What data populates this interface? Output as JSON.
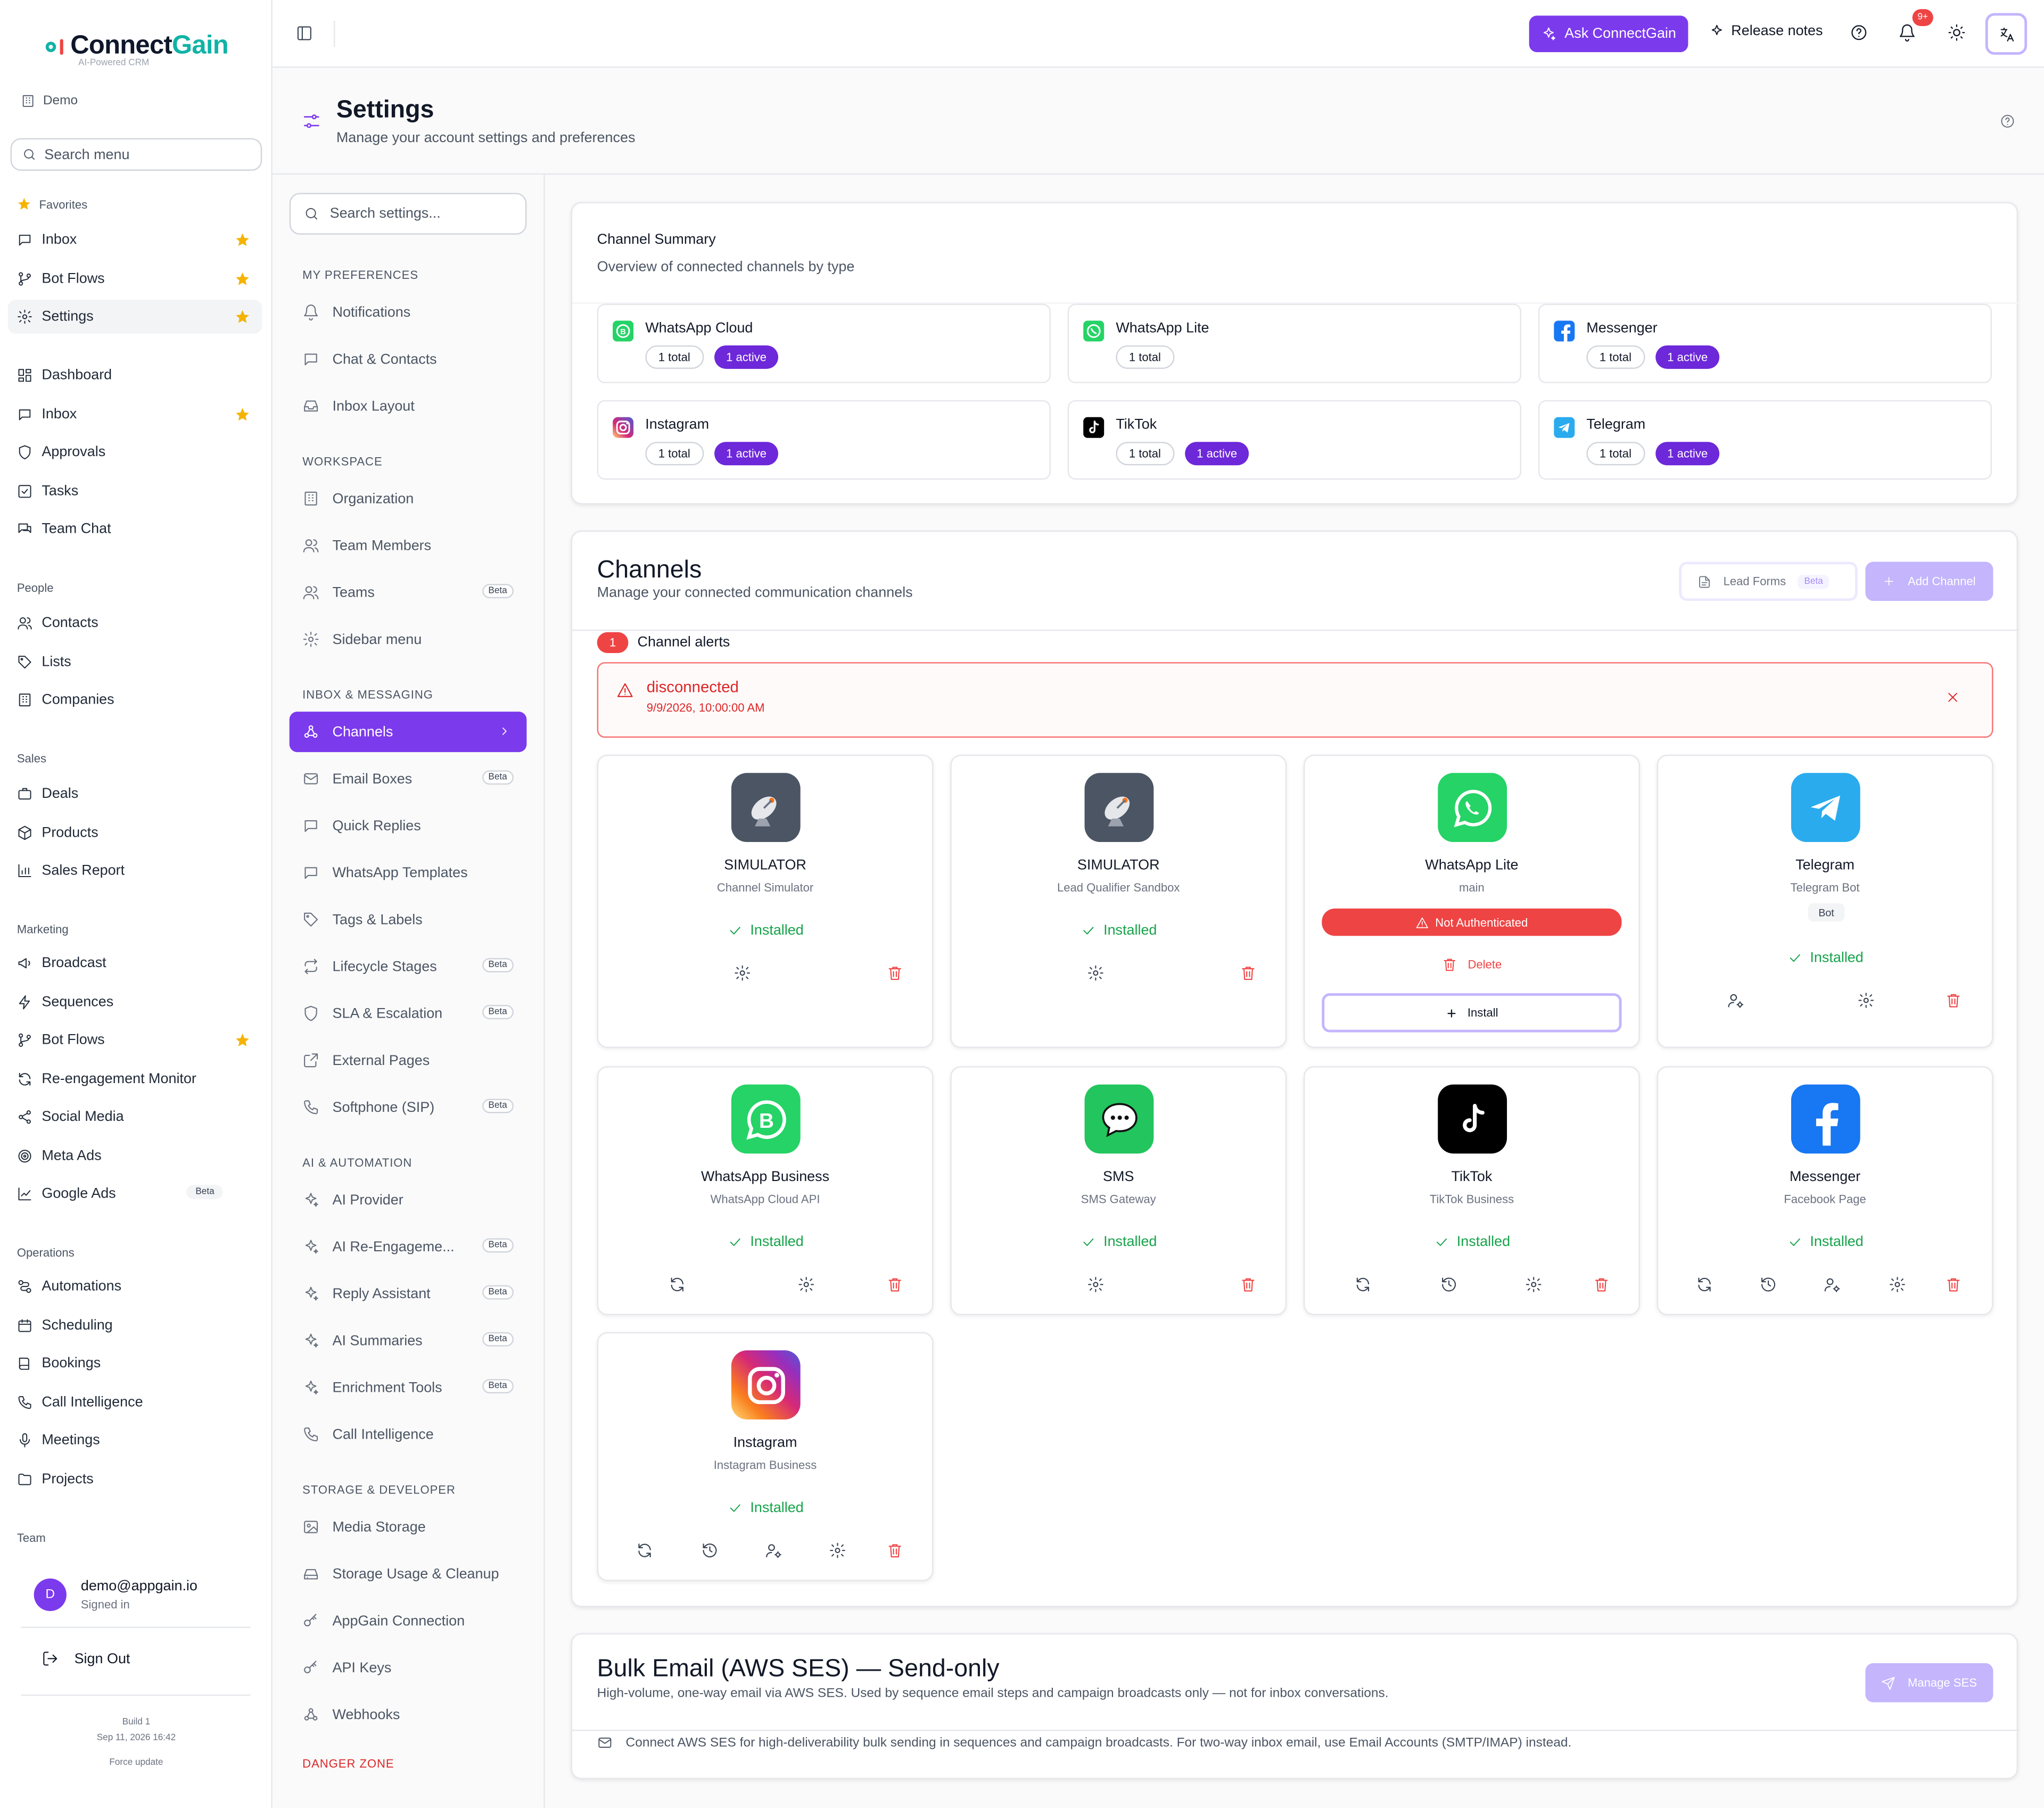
{
  "brand": {
    "name_a": "Connect",
    "name_b": "Gain",
    "tagline": "AI-Powered CRM"
  },
  "org": {
    "name": "Demo"
  },
  "sidebar": {
    "search_placeholder": "Search menu",
    "favorites_label": "Favorites",
    "favorites": [
      "Inbox",
      "Bot Flows",
      "Settings"
    ],
    "main": [
      "Dashboard",
      "Inbox",
      "Approvals",
      "Tasks",
      "Team Chat"
    ],
    "people_label": "People",
    "people": [
      "Contacts",
      "Lists",
      "Companies"
    ],
    "sales_label": "Sales",
    "sales": [
      "Deals",
      "Products",
      "Sales Report"
    ],
    "marketing_label": "Marketing",
    "marketing": [
      "Broadcast",
      "Sequences",
      "Bot Flows",
      "Re-engagement Monitor",
      "Social Media",
      "Meta Ads",
      "Google Ads"
    ],
    "google_ads_badge": "Beta",
    "operations_label": "Operations",
    "operations": [
      "Automations",
      "Scheduling",
      "Bookings",
      "Call Intelligence",
      "Meetings",
      "Projects"
    ],
    "team_label": "Team",
    "user": {
      "initial": "D",
      "email": "demo@appgain.io",
      "status": "Signed in"
    },
    "sign_out": "Sign Out",
    "build": "Build 1",
    "build_date": "Sep 11, 2026 16:42",
    "force_update": "Force update"
  },
  "topbar": {
    "ask": "Ask ConnectGain",
    "release_notes": "Release notes",
    "notif_count": "9+"
  },
  "page": {
    "title": "Settings",
    "subtitle": "Manage your account settings and preferences"
  },
  "settings_nav": {
    "search_placeholder": "Search settings...",
    "sections": [
      {
        "label": "MY PREFERENCES",
        "items": [
          {
            "label": "Notifications",
            "icon": "bell-icon"
          },
          {
            "label": "Chat & Contacts",
            "icon": "chat-icon"
          },
          {
            "label": "Inbox Layout",
            "icon": "inbox-icon"
          }
        ]
      },
      {
        "label": "WORKSPACE",
        "items": [
          {
            "label": "Organization",
            "icon": "building-icon"
          },
          {
            "label": "Team Members",
            "icon": "users-icon"
          },
          {
            "label": "Teams",
            "icon": "users-icon",
            "beta": "Beta"
          },
          {
            "label": "Sidebar menu",
            "icon": "gear-icon"
          }
        ]
      },
      {
        "label": "INBOX & MESSAGING",
        "items": [
          {
            "label": "Channels",
            "icon": "webhook-icon",
            "active": true
          },
          {
            "label": "Email Boxes",
            "icon": "mail-icon",
            "beta": "Beta"
          },
          {
            "label": "Quick Replies",
            "icon": "chat-icon"
          },
          {
            "label": "WhatsApp Templates",
            "icon": "chat-icon"
          },
          {
            "label": "Tags & Labels",
            "icon": "tag-icon"
          },
          {
            "label": "Lifecycle Stages",
            "icon": "repeat-icon",
            "beta": "Beta"
          },
          {
            "label": "SLA & Escalation",
            "icon": "shield-icon",
            "beta": "Beta"
          },
          {
            "label": "External Pages",
            "icon": "external-icon"
          },
          {
            "label": "Softphone (SIP)",
            "icon": "phone-icon",
            "beta": "Beta"
          }
        ]
      },
      {
        "label": "AI & AUTOMATION",
        "items": [
          {
            "label": "AI Provider",
            "icon": "sparkle-icon"
          },
          {
            "label": "AI Re-Engageme...",
            "icon": "sparkle-icon",
            "beta": "Beta"
          },
          {
            "label": "Reply Assistant",
            "icon": "sparkle-icon",
            "beta": "Beta"
          },
          {
            "label": "AI Summaries",
            "icon": "sparkle-icon",
            "beta": "Beta"
          },
          {
            "label": "Enrichment Tools",
            "icon": "sparkle-icon",
            "beta": "Beta"
          },
          {
            "label": "Call Intelligence",
            "icon": "phone-icon"
          }
        ]
      },
      {
        "label": "STORAGE & DEVELOPER",
        "items": [
          {
            "label": "Media Storage",
            "icon": "image-icon"
          },
          {
            "label": "Storage Usage & Cleanup",
            "icon": "drive-icon"
          },
          {
            "label": "AppGain Connection",
            "icon": "key-icon"
          },
          {
            "label": "API Keys",
            "icon": "key-icon"
          },
          {
            "label": "Webhooks",
            "icon": "webhook-icon"
          }
        ]
      }
    ],
    "danger_zone": "DANGER ZONE"
  },
  "summary": {
    "title": "Channel Summary",
    "subtitle": "Overview of connected channels by type",
    "items": [
      {
        "name": "WhatsApp Cloud",
        "total": "1 total",
        "active": "1 active"
      },
      {
        "name": "WhatsApp Lite",
        "total": "1 total"
      },
      {
        "name": "Messenger",
        "total": "1 total",
        "active": "1 active"
      },
      {
        "name": "Instagram",
        "total": "1 total",
        "active": "1 active"
      },
      {
        "name": "TikTok",
        "total": "1 total",
        "active": "1 active"
      },
      {
        "name": "Telegram",
        "total": "1 total",
        "active": "1 active"
      }
    ]
  },
  "channels": {
    "title": "Channels",
    "subtitle": "Manage your connected communication channels",
    "lead_forms": "Lead Forms",
    "lead_forms_badge": "Beta",
    "add_channel": "Add Channel",
    "alerts_count": "1",
    "alerts_label": "Channel alerts",
    "alert": {
      "title": "disconnected",
      "time": "9/9/2026, 10:00:00 AM"
    },
    "installed_label": "Installed",
    "tiles": [
      {
        "name": "SIMULATOR",
        "sub": "Channel Simulator"
      },
      {
        "name": "SIMULATOR",
        "sub": "Lead Qualifier Sandbox"
      },
      {
        "name": "WhatsApp Lite",
        "sub": "main",
        "not_auth": "Not Authenticated",
        "delete": "Delete",
        "install": "Install"
      },
      {
        "name": "Telegram",
        "sub": "Telegram Bot",
        "badge": "Bot"
      },
      {
        "name": "WhatsApp Business",
        "sub": "WhatsApp Cloud API"
      },
      {
        "name": "SMS",
        "sub": "SMS Gateway"
      },
      {
        "name": "TikTok",
        "sub": "TikTok Business"
      },
      {
        "name": "Messenger",
        "sub": "Facebook Page"
      },
      {
        "name": "Instagram",
        "sub": "Instagram Business"
      }
    ]
  },
  "ses": {
    "title": "Bulk Email (AWS SES) — Send-only",
    "subtitle": "High-volume, one-way email via AWS SES. Used by sequence email steps and campaign broadcasts only — not for inbox conversations.",
    "button": "Manage SES",
    "note": "Connect AWS SES for high-deliverability bulk sending in sequences and campaign broadcasts. For two-way inbox email, use Email Accounts (SMTP/IMAP) instead."
  },
  "colors": {
    "accent": "#7c3aed",
    "success": "#16a34a",
    "danger": "#ef4444"
  }
}
